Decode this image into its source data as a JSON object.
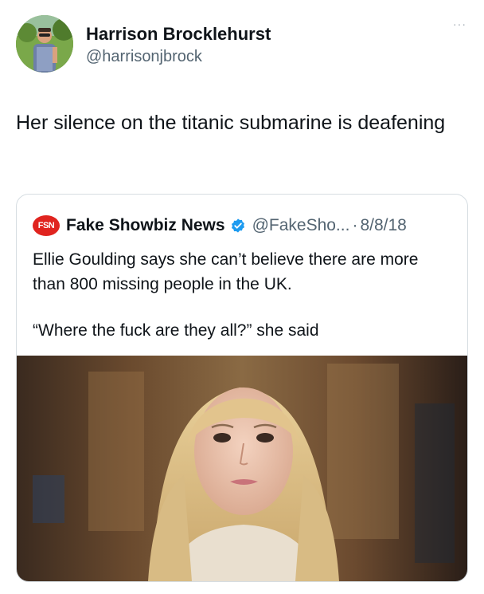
{
  "tweet": {
    "author": {
      "display_name": "Harrison Brocklehurst",
      "handle": "@harrisonjbrock"
    },
    "more_label": "···",
    "text": "Her silence on the titanic submarine is deafening"
  },
  "quoted_tweet": {
    "logo_text": "FSN",
    "author_name": "Fake Showbiz News",
    "handle": "@FakeSho...",
    "separator": "·",
    "date": "8/8/18",
    "text": "Ellie Goulding says she can’t believe there are more than 800 missing people in the UK.",
    "quote": "“Where the fuck are they all?” she said",
    "verified_color": "#1d9bf0"
  },
  "colors": {
    "text_primary": "#0f1419",
    "text_secondary": "#536471",
    "brand_red": "#e0241f"
  }
}
